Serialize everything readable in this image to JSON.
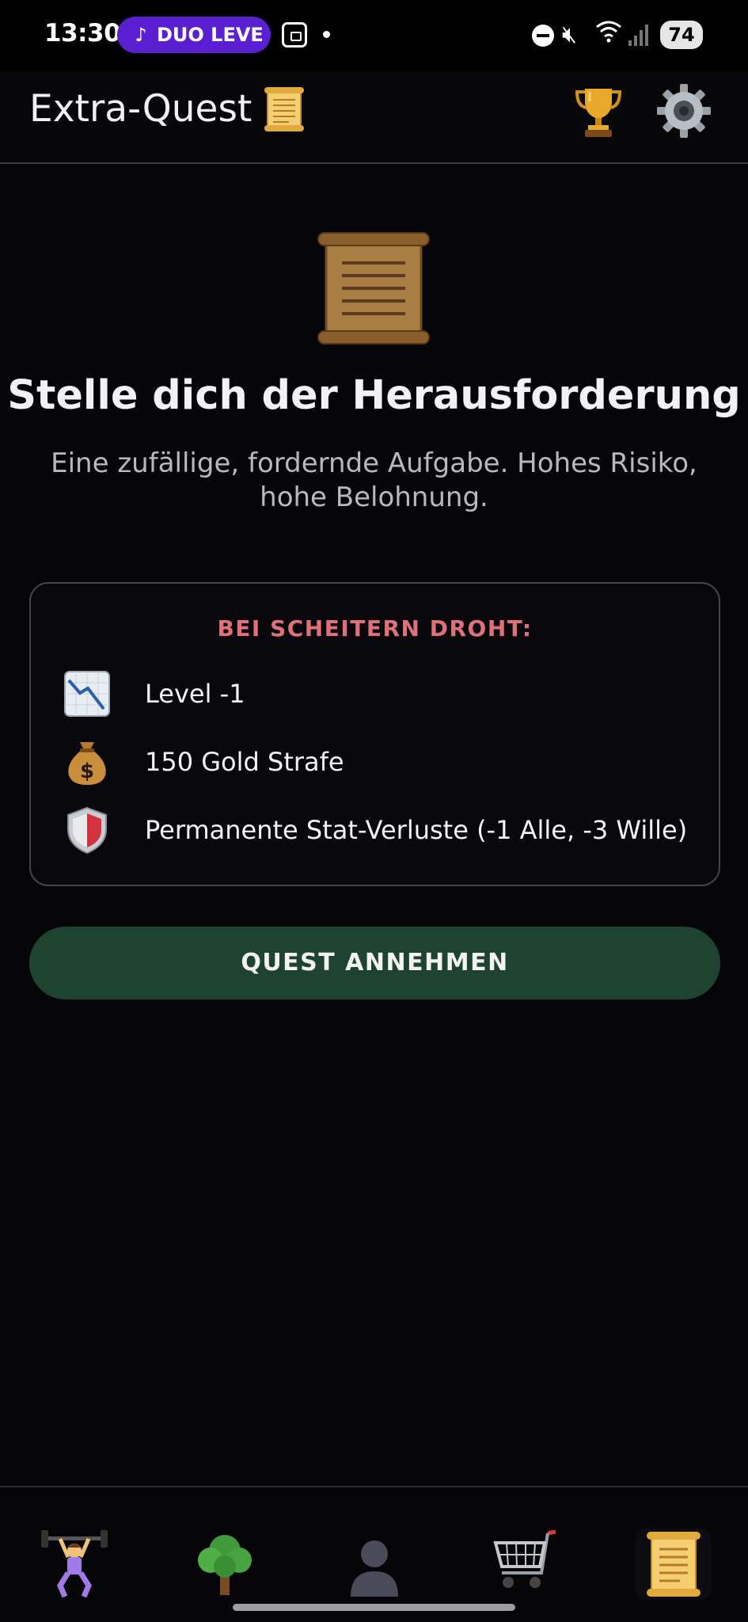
{
  "status_bar": {
    "time": "13:30",
    "media_pill": "DUO LEVEL",
    "battery": "74"
  },
  "app_bar": {
    "title": "Extra-Quest",
    "title_icon": "scroll-icon",
    "actions": [
      "trophy-icon",
      "gear-icon"
    ]
  },
  "main": {
    "hero_icon": "scroll-icon",
    "headline": "Stelle dich der Herausforderung",
    "subline": "Eine zufällige, fordernde Aufgabe. Hohes Risiko, hohe Belohnung."
  },
  "risk_card": {
    "title": "BEI SCHEITERN DROHT:",
    "items": [
      {
        "icon": "chart-decreasing-icon",
        "label": "Level -1"
      },
      {
        "icon": "money-bag-icon",
        "label": "150 Gold Strafe"
      },
      {
        "icon": "shield-icon",
        "label": "Permanente Stat-Verluste (-1 Alle, -3 Wille)"
      }
    ]
  },
  "accept_button": {
    "label": "QUEST ANNEHMEN"
  },
  "bottom_nav": {
    "items": [
      {
        "icon": "weightlifter-icon",
        "active": false
      },
      {
        "icon": "tree-icon",
        "active": false
      },
      {
        "icon": "profile-silhouette-icon",
        "active": false
      },
      {
        "icon": "shopping-cart-icon",
        "active": false
      },
      {
        "icon": "scroll-icon",
        "active": true
      }
    ]
  },
  "colors": {
    "background": "#060609",
    "warning_title": "#e0707a",
    "accept_button": "#1f4331",
    "status_pill": "#5b1fd2"
  }
}
